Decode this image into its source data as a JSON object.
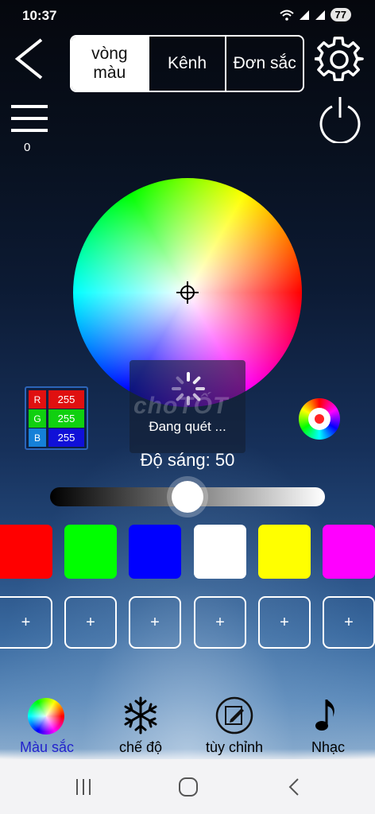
{
  "status_bar": {
    "time": "10:37",
    "battery": "77"
  },
  "tabs": [
    {
      "label": "vòng\nmàu"
    },
    {
      "label": "Kênh"
    },
    {
      "label": "Đơn sắc"
    }
  ],
  "menu_count": "0",
  "loading": {
    "message": "Đang quét ..."
  },
  "watermark": "choTỐT",
  "rgb": [
    {
      "label": "R",
      "value": "255",
      "color": "#e01010"
    },
    {
      "label": "G",
      "value": "255",
      "color": "#10d010"
    },
    {
      "label": "B",
      "value": "255",
      "color": "#1010d8"
    }
  ],
  "brightness": {
    "label": "Độ sáng: 50",
    "value": 50,
    "max": 100
  },
  "swatch_colors": [
    "#ff0000",
    "#00ff00",
    "#0000ff",
    "#ffffff",
    "#ffff00",
    "#ff00ff"
  ],
  "slot_label": "+",
  "bottom_nav": [
    {
      "label": "Màu sắc",
      "icon": "color-wheel-icon",
      "active": true
    },
    {
      "label": "chế độ",
      "icon": "snowflake-icon",
      "active": false
    },
    {
      "label": "tùy chỉnh",
      "icon": "edit-icon",
      "active": false
    },
    {
      "label": "Nhạc",
      "icon": "music-note-icon",
      "active": false
    }
  ]
}
